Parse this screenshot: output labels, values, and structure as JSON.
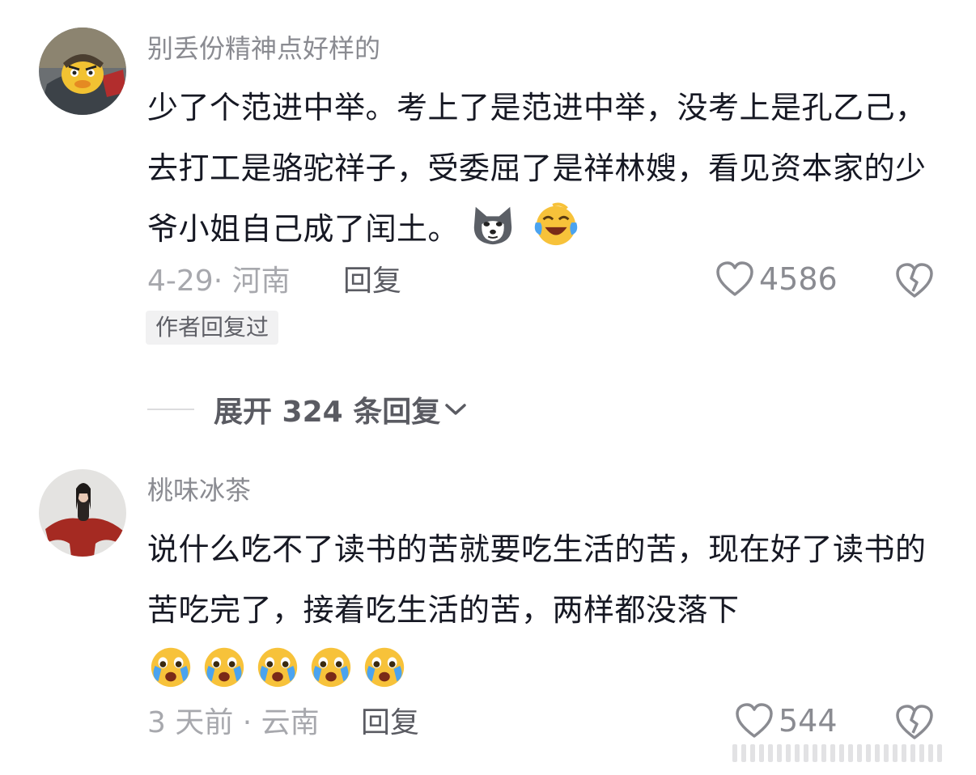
{
  "comments": [
    {
      "username": "别丢份精神点好样的",
      "text": "少了个范进中举。考上了是范进中举，没考上是孔乙己，去打工是骆驼祥子，受委屈了是祥林嫂，看见资本家的少爷小姐自己成了闰土。",
      "emojis": [
        "husky-dog-emoji",
        "laughing-tears-emoji"
      ],
      "date_location": "4-29· 河南",
      "reply_label": "回复",
      "likes": "4586",
      "tag": "作者回复过",
      "expand_label": "展开 324 条回复"
    },
    {
      "username": "桃味冰茶",
      "text": "说什么吃不了读书的苦就要吃生活的苦，现在好了读书的苦吃完了，接着吃生活的苦，两样都没落下",
      "emojis": [
        "crying-face-emoji",
        "crying-face-emoji",
        "crying-face-emoji",
        "crying-face-emoji",
        "crying-face-emoji"
      ],
      "date_location": "3 天前 · 云南",
      "reply_label": "回复",
      "likes": "544"
    }
  ]
}
